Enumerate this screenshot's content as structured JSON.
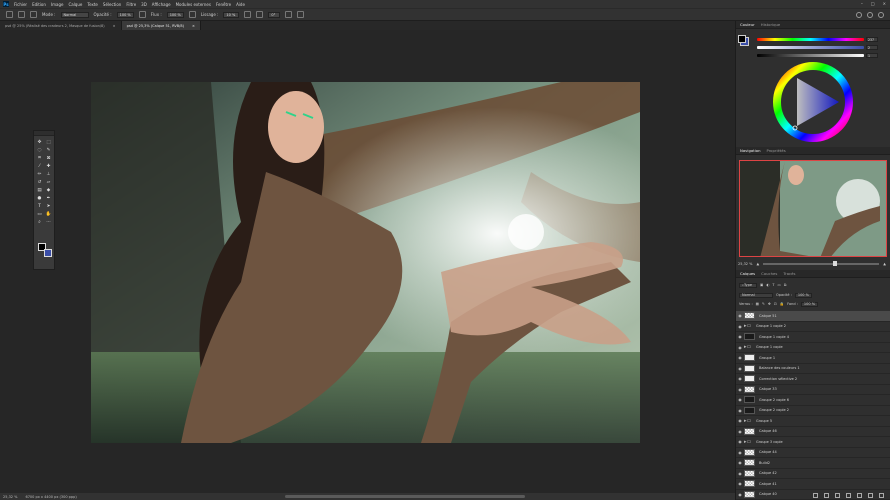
{
  "menu": [
    "Fichier",
    "Edition",
    "Image",
    "Calque",
    "Texte",
    "Sélection",
    "Filtre",
    "3D",
    "Affichage",
    "Modules externes",
    "Fenêtre",
    "Aide"
  ],
  "app_icon": "Ps",
  "options": {
    "mode_label": "Mode :",
    "mode_value": "Normal",
    "opacity_label": "Opacité :",
    "opacity_value": "100 %",
    "flow_label": "Flux :",
    "flow_value": "100 %",
    "smoothing_label": "Lissage :",
    "smoothing_value": "10 %",
    "angle_value": "0°"
  },
  "tabs": [
    {
      "label": "psd @ 25% (Réalisé des cradeurs 2, Masque de fusion/8)",
      "close": "×"
    },
    {
      "label": "psd @ 25,3% (Calque 51, RVB/8)",
      "close": "×"
    }
  ],
  "status": {
    "zoom": "25,32 %",
    "doc": "6700 px x 4400 px (300 ppp)"
  },
  "color_panel": {
    "tabs": [
      "Couleur",
      "Historique"
    ],
    "values": [
      "237",
      "2",
      "1"
    ]
  },
  "nav_panel": {
    "tabs": [
      "Navigation",
      "Propriétés"
    ],
    "zoom": "25,32 %"
  },
  "layers_panel": {
    "tabs": [
      "Calques",
      "Couches",
      "Tracés"
    ],
    "filter": "Type",
    "blend": "Normal",
    "opacity_label": "Opacité :",
    "opacity_value": "100 %",
    "lock_label": "Verrou :",
    "fill_label": "Fond :",
    "fill_value": "100 %",
    "layers": [
      {
        "name": "Calque 51",
        "kind": "pixel",
        "selected": true
      },
      {
        "name": "Groupe 1 copie 2",
        "kind": "folder",
        "selected": false
      },
      {
        "name": "Groupe 1 copie 4",
        "kind": "dark",
        "selected": false
      },
      {
        "name": "Groupe 1 copie",
        "kind": "folder",
        "selected": false
      },
      {
        "name": "Groupe 1",
        "kind": "adj",
        "selected": false
      },
      {
        "name": "Balance des couleurs 1",
        "kind": "adj",
        "selected": false
      },
      {
        "name": "Correction sélective 2",
        "kind": "adj",
        "selected": false
      },
      {
        "name": "Calque 33",
        "kind": "pixel",
        "selected": false
      },
      {
        "name": "Groupe 2 copie 6",
        "kind": "dark",
        "selected": false
      },
      {
        "name": "Groupe 2 copie 2",
        "kind": "dark",
        "selected": false
      },
      {
        "name": "Groupe 5",
        "kind": "folder",
        "selected": false
      },
      {
        "name": "Calque 46",
        "kind": "pixel",
        "selected": false
      },
      {
        "name": "Groupe 3 copie",
        "kind": "folder",
        "selected": false
      },
      {
        "name": "Calque 44",
        "kind": "pixel",
        "selected": false
      },
      {
        "name": "Build2",
        "kind": "pixel",
        "selected": false
      },
      {
        "name": "Calque 42",
        "kind": "pixel",
        "selected": false
      },
      {
        "name": "Calque 41",
        "kind": "pixel",
        "selected": false
      },
      {
        "name": "Calque 40",
        "kind": "pixel",
        "selected": false
      }
    ]
  },
  "colors": {
    "foreground": "#000000",
    "background": "#3b4ea8",
    "accent": "#31a8ff"
  }
}
